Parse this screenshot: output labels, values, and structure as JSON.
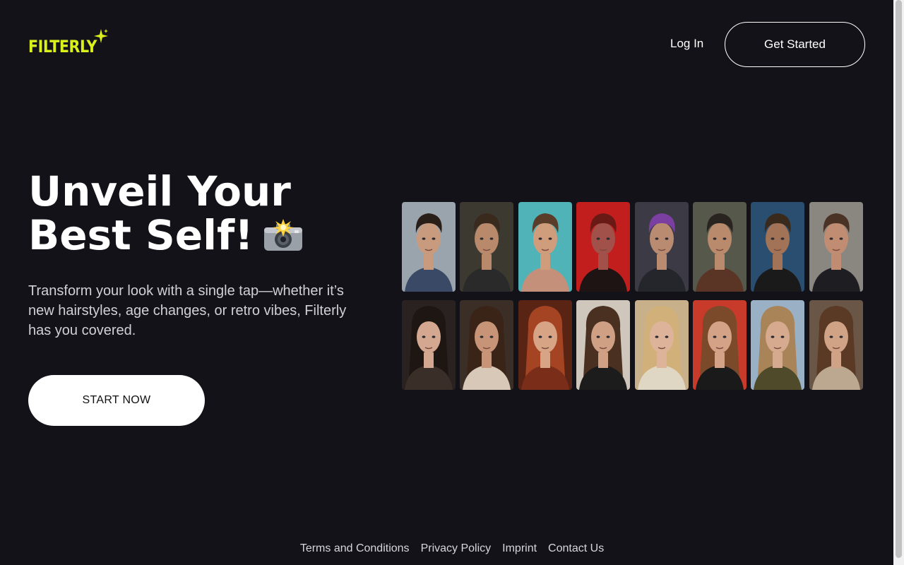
{
  "header": {
    "logo": "FILTERLY",
    "login_label": "Log In",
    "cta_label": "Get Started"
  },
  "hero": {
    "title_line1": "Unveil Your",
    "title_line2": "Best Self!",
    "title_icon": "camera-flash-icon",
    "subtitle": "Transform your look with a single tap—whether it’s new hairstyles, age changes, or retro vibes, Filterly has you covered.",
    "button_label": "START NOW"
  },
  "gallery": {
    "rows": 2,
    "columns": 8
  },
  "footer": {
    "links": [
      "Terms and Conditions",
      "Privacy Policy",
      "Imprint",
      "Contact Us"
    ]
  },
  "colors": {
    "background": "#121218",
    "brand": "#d9f01a",
    "text": "#ffffff"
  }
}
